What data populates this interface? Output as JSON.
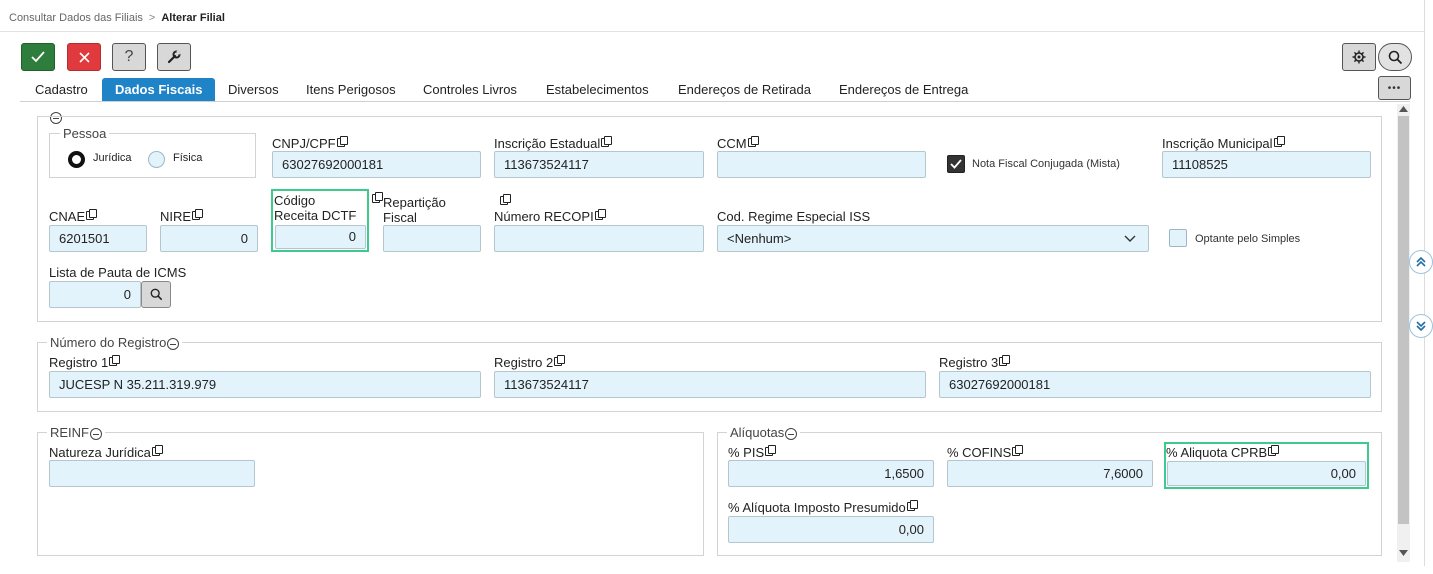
{
  "breadcrumb": {
    "parent": "Consultar Dados das Filiais",
    "separator": ">",
    "current": "Alterar Filial"
  },
  "toolbar": {
    "confirm_icon": "check-icon",
    "cancel_icon": "close-icon",
    "help_label": "?",
    "tools_icon": "wrench-icon",
    "settings_icon": "gear-icon",
    "search_icon": "search-icon",
    "more_label": "•••"
  },
  "tabs": [
    {
      "label": "Cadastro",
      "active": false
    },
    {
      "label": "Dados Fiscais",
      "active": true
    },
    {
      "label": "Diversos",
      "active": false
    },
    {
      "label": "Itens Perigosos",
      "active": false
    },
    {
      "label": "Controles Livros",
      "active": false
    },
    {
      "label": "Estabelecimentos",
      "active": false
    },
    {
      "label": "Endereços de Retirada",
      "active": false
    },
    {
      "label": "Endereços de Entrega",
      "active": false
    }
  ],
  "pessoa": {
    "legend": "Pessoa",
    "juridica": "Jurídica",
    "fisica": "Física",
    "selected": "Jurídica"
  },
  "fields": {
    "cnpj": {
      "label": "CNPJ/CPF",
      "value": "63027692000181"
    },
    "inscricao_estadual": {
      "label": "Inscrição Estadual",
      "value": "113673524117"
    },
    "ccm": {
      "label": "CCM",
      "value": ""
    },
    "nota_fiscal_conjugada": {
      "label": "Nota Fiscal Conjugada (Mista)",
      "checked": true
    },
    "inscricao_municipal": {
      "label": "Inscrição Municipal",
      "value": "11108525"
    },
    "cnae": {
      "label": "CNAE",
      "value": "6201501"
    },
    "nire": {
      "label": "NIRE",
      "value": "0"
    },
    "codigo_receita": {
      "label_line1": "Código",
      "label_line2": "Receita DCTF",
      "value": "0"
    },
    "reparticao": {
      "label_line1": "Repartição",
      "label_line2": "Fiscal",
      "value": ""
    },
    "recopi": {
      "label": "Número RECOPI",
      "value": ""
    },
    "regime_iss": {
      "label": "Cod. Regime Especial ISS",
      "value": "<Nenhum>"
    },
    "optante_simples": {
      "label": "Optante pelo Simples",
      "checked": false
    },
    "pauta_icms": {
      "label": "Lista de Pauta de ICMS",
      "value": "0"
    }
  },
  "registro": {
    "legend": "Número do Registro",
    "r1": {
      "label": "Registro 1",
      "value": "JUCESP N 35.211.319.979"
    },
    "r2": {
      "label": "Registro 2",
      "value": "113673524117"
    },
    "r3": {
      "label": "Registro 3",
      "value": "63027692000181"
    }
  },
  "reinf": {
    "legend": "REINF",
    "natureza": {
      "label": "Natureza Jurídica",
      "value": ""
    }
  },
  "aliquotas": {
    "legend": "Alíquotas",
    "pis": {
      "label": "% PIS",
      "value": "1,6500"
    },
    "cofins": {
      "label": "% COFINS",
      "value": "7,6000"
    },
    "cprb": {
      "label": "% Aliquota CPRB",
      "value": "0,00"
    },
    "presumido": {
      "label": "% Alíquota Imposto Presumido",
      "value": "0,00"
    }
  },
  "colors": {
    "active_tab": "#1f83c8",
    "field_bg": "#e3f3fb",
    "highlight": "#3ec98f",
    "confirm": "#2e7d3c",
    "cancel": "#e0393e"
  }
}
